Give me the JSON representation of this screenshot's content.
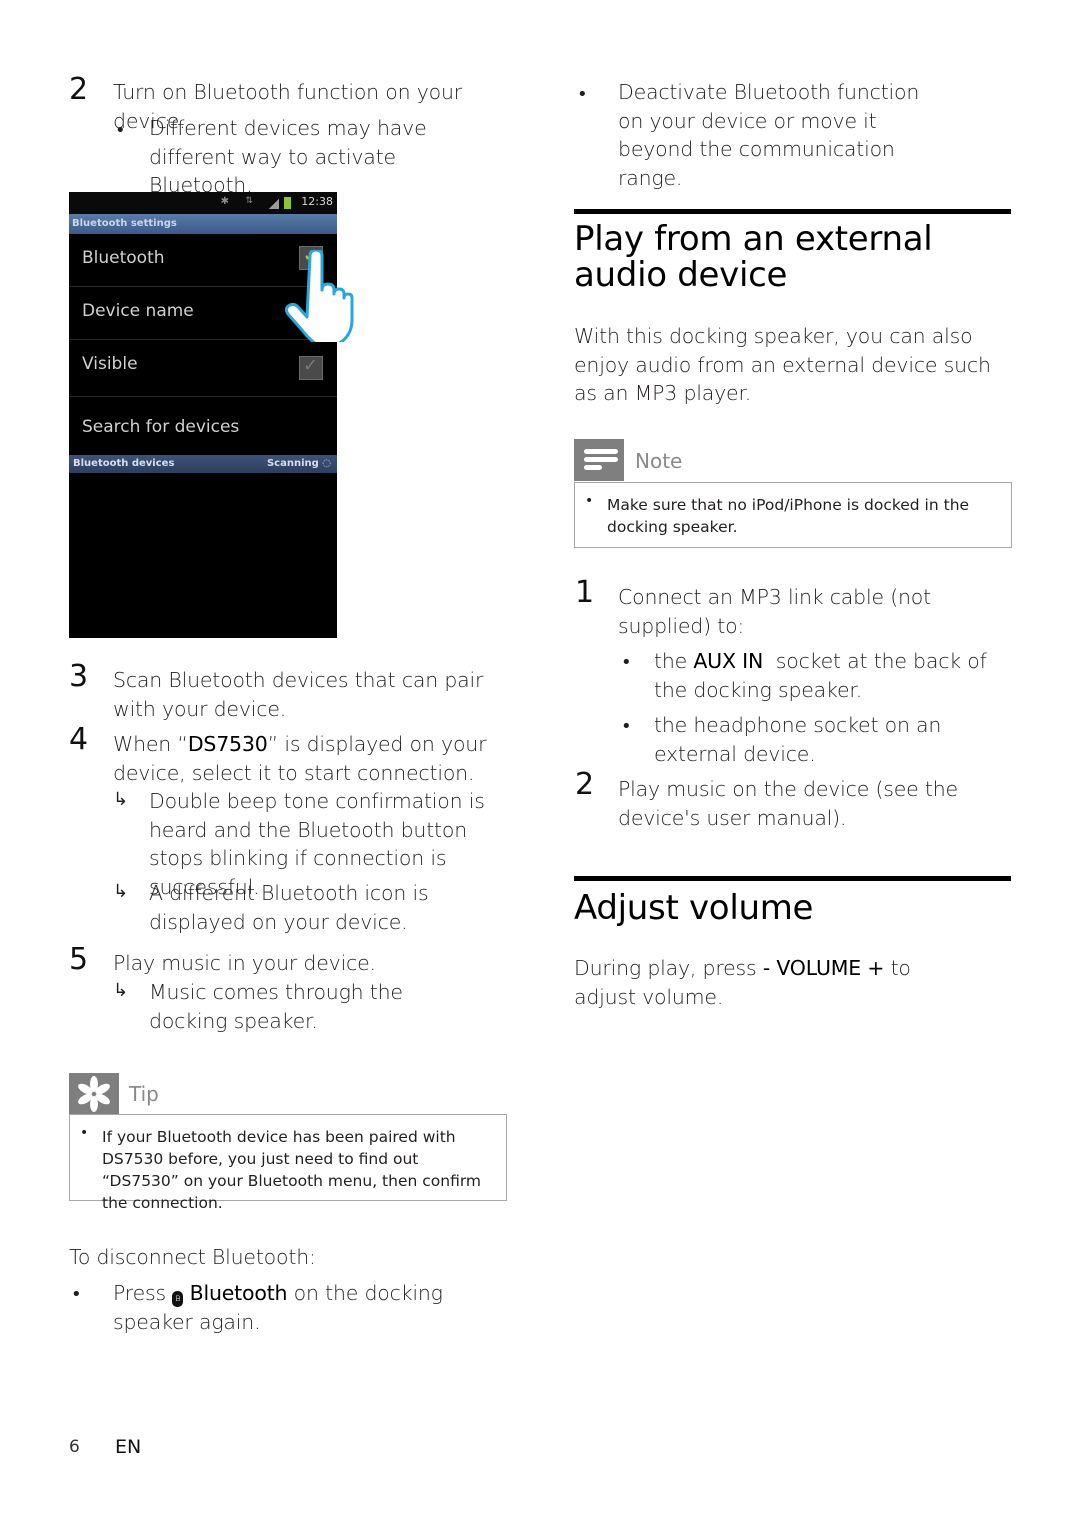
{
  "left_column": {
    "step2": {
      "number": "2",
      "text": "Turn on Bluetooth function on your device.",
      "bullet": "Different devices may have different way to activate Bluetooth."
    },
    "phone_screenshot": {
      "status_time": "12:38",
      "title": "Bluetooth settings",
      "rows": [
        {
          "label": "Bluetooth",
          "checkbox": "checked"
        },
        {
          "label": "Device name"
        },
        {
          "label": "Visible",
          "checkbox": "checked-dim"
        },
        {
          "label": "Search for devices"
        }
      ],
      "subhead": "Bluetooth devices",
      "scanning": "Scanning"
    },
    "step3": {
      "number": "3",
      "text": "Scan Bluetooth devices that can pair with your device."
    },
    "step4": {
      "number": "4",
      "text_before": "When “",
      "text_bold": "DS7530",
      "text_after": "” is displayed on your device, select it to start connection.",
      "results": [
        "Double beep tone confirmation is heard and the Bluetooth button stops blinking if connection is successful.",
        "A different Bluetooth icon is displayed on your device."
      ]
    },
    "step5": {
      "number": "5",
      "text": "Play music in your device.",
      "result": "Music comes through the docking speaker."
    },
    "tip": {
      "label": "Tip",
      "text": "If your Bluetooth device has been paired with DS7530 before, you just need to find out “DS7530” on your Bluetooth menu, then confirm the connection."
    },
    "disconnect": {
      "heading": "To disconnect Bluetooth:",
      "press": "Press",
      "button": "Bluetooth",
      "rest": "on the docking speaker again."
    }
  },
  "right_column": {
    "deactivate_bullet": "Deactivate Bluetooth function on your device or move it beyond the communication range.",
    "section1": {
      "title": "Play from an external audio device",
      "intro": "With this docking speaker, you can also enjoy audio from an external device such as an MP3 player.",
      "note": {
        "label": "Note",
        "text": "Make sure that no iPod/iPhone is docked in the docking speaker."
      },
      "step1": {
        "number": "1",
        "text": "Connect an MP3 link cable (not supplied) to:",
        "bullets": [
          {
            "prefix": "the ",
            "bold": "AUX IN",
            "rest": "  socket at the back of the docking speaker."
          },
          {
            "text": "the headphone socket on an external device."
          }
        ]
      },
      "step2": {
        "number": "2",
        "text": "Play music on the device (see the device's user manual)."
      }
    },
    "section2": {
      "title": "Adjust volume",
      "text_before": "During play, press ",
      "text_bold": "- VOLUME +",
      "text_after": " to adjust volume."
    }
  },
  "footer": {
    "page_number": "6",
    "language": "EN"
  }
}
